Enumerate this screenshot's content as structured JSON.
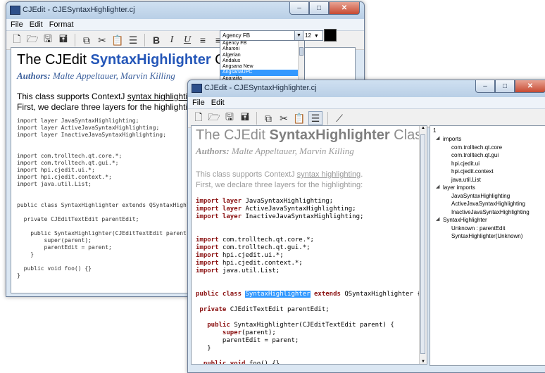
{
  "back_window": {
    "title": "CJEdit - CJESyntaxHighlighter.cj",
    "menu": [
      "File",
      "Edit",
      "Format"
    ],
    "font_combo_value": "Agency FB",
    "font_size_value": "12",
    "font_options": [
      "Agency FB",
      "Aharoni",
      "Algerian",
      "Andalus",
      "Angsana New",
      "AngsanaUPC",
      "Aparajita"
    ],
    "selected_font": "AngsanaUPC",
    "doc_title_pre": "The CJEdit ",
    "doc_title_hl": "SyntaxHighlighter",
    "doc_title_post": " Class",
    "authors_label": "Authors:",
    "authors_names": " Malte Appeltauer, Marvin Killing",
    "para_line1_pre": "This class supports ContextJ ",
    "para_line1_link": "syntax highlighting",
    "para_line1_post": ".",
    "para_line2": "First, we declare three layers for the highlighting:",
    "code": [
      "import layer JavaSyntaxHighlighting;",
      "import layer ActiveJavaSyntaxHighlighting;",
      "import layer InactiveJavaSyntaxHighlighting;",
      "",
      "",
      "import com.trolltech.qt.core.*;",
      "import com.trolltech.qt.gui.*;",
      "import hpi.cjedit.ui.*;",
      "import hpi.cjedit.context.*;",
      "import java.util.List;",
      "",
      "",
      "public class SyntaxHighlighter extends QSyntaxHighligh",
      "",
      "  private CJEditTextEdit parentEdit;",
      "",
      "    public SyntaxHighlighter(CJEditTextEdit parent) {",
      "        super(parent);",
      "        parentEdit = parent;",
      "    }",
      "",
      "  public void foo() {}",
      "}"
    ]
  },
  "front_window": {
    "title": "CJEdit - CJESyntaxHighlighter.cj",
    "menu": [
      "File",
      "Edit"
    ],
    "doc_title_pre": "The CJEdit ",
    "doc_title_hl": "SyntaxHighlighter",
    "doc_title_post": " Class",
    "authors_label": "Authors:",
    "authors_names": " Malte Appeltauer, Marvin Killing",
    "para_line1_pre": "This class supports ContextJ ",
    "para_line1_link": "syntax highlighting",
    "para_line1_post": ".",
    "para_line2": "First, we declare three layers for the highlighting:",
    "code_lines": [
      [
        {
          "t": "import layer ",
          "k": true
        },
        {
          "t": "JavaSyntaxHighlighting;"
        }
      ],
      [
        {
          "t": "import layer ",
          "k": true
        },
        {
          "t": "ActiveJavaSyntaxHighlighting;"
        }
      ],
      [
        {
          "t": "import layer ",
          "k": true
        },
        {
          "t": "InactiveJavaSyntaxHighlighting;"
        }
      ],
      [],
      [],
      [
        {
          "t": "import ",
          "k": true
        },
        {
          "t": "com.trolltech.qt.core.*;"
        }
      ],
      [
        {
          "t": "import ",
          "k": true
        },
        {
          "t": "com.trolltech.qt.gui.*;"
        }
      ],
      [
        {
          "t": "import ",
          "k": true
        },
        {
          "t": "hpi.cjedit.ui.*;"
        }
      ],
      [
        {
          "t": "import ",
          "k": true
        },
        {
          "t": "hpi.cjedit.context.*;"
        }
      ],
      [
        {
          "t": "import ",
          "k": true
        },
        {
          "t": "java.util.List;"
        }
      ],
      [],
      [],
      [
        {
          "t": "public class ",
          "k": true
        },
        {
          "t": "SyntaxHighlighter",
          "s": true
        },
        {
          "t": " "
        },
        {
          "t": "extends ",
          "k": true
        },
        {
          "t": "QSyntaxHighlighter {"
        }
      ],
      [],
      [
        {
          "t": " private ",
          "k": true
        },
        {
          "t": "CJEditTextEdit parentEdit;"
        }
      ],
      [],
      [
        {
          "t": "   public ",
          "k": true
        },
        {
          "t": "SyntaxHighlighter(CJEditTextEdit parent) {"
        }
      ],
      [
        {
          "t": "       super",
          "k": true
        },
        {
          "t": "(parent);"
        }
      ],
      [
        {
          "t": "       parentEdit = parent;"
        }
      ],
      [
        {
          "t": "   }"
        }
      ],
      [],
      [
        {
          "t": "  public void ",
          "k": true
        },
        {
          "t": "foo() {}"
        }
      ]
    ],
    "outline_header": "1",
    "outline": [
      {
        "label": "imports",
        "level": 0,
        "expandable": true
      },
      {
        "label": "com.trolltech.qt.core",
        "level": 1
      },
      {
        "label": "com.trolltech.qt.gui",
        "level": 1
      },
      {
        "label": "hpi.cjedit.ui",
        "level": 1
      },
      {
        "label": "hpi.cjedit.context",
        "level": 1
      },
      {
        "label": "java.util.List",
        "level": 1
      },
      {
        "label": "layer imports",
        "level": 0,
        "expandable": true
      },
      {
        "label": "JavaSyntaxHighlighting",
        "level": 1
      },
      {
        "label": "ActiveJavaSyntaxHighlighting",
        "level": 1
      },
      {
        "label": "InactiveJavaSyntaxHighlighting",
        "level": 1
      },
      {
        "label": "SyntaxHighlighter",
        "level": 0,
        "expandable": true
      },
      {
        "label": "Unknown : parentEdit",
        "level": 1
      },
      {
        "label": "SyntaxHighlighter(Unknown)",
        "level": 1
      }
    ]
  }
}
